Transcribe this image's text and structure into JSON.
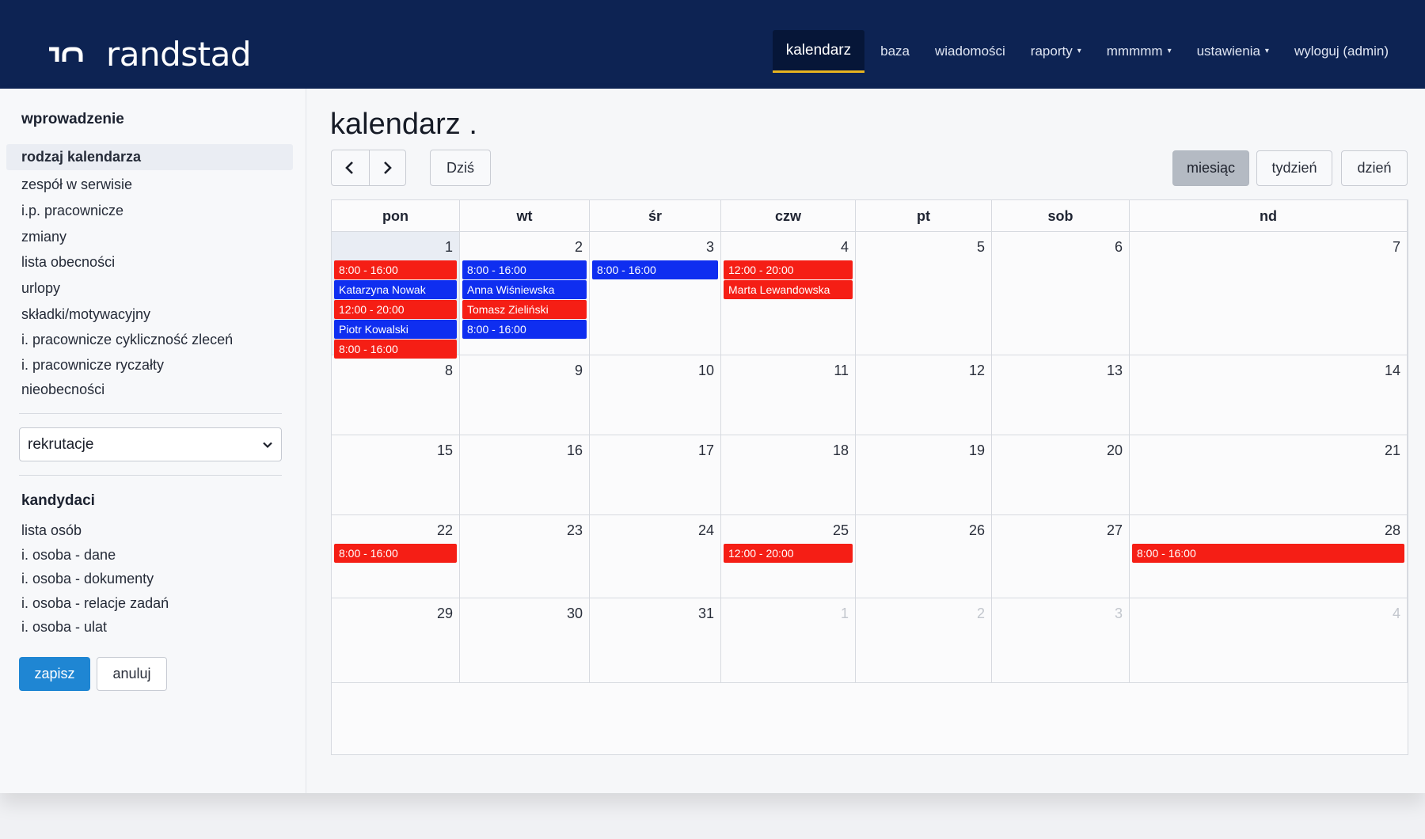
{
  "brand": {
    "name": "randstad"
  },
  "nav": [
    {
      "label": "kalendarz",
      "active": true,
      "dropdown": false
    },
    {
      "label": "baza",
      "active": false,
      "dropdown": false
    },
    {
      "label": "wiadomości",
      "active": false,
      "dropdown": false
    },
    {
      "label": "raporty",
      "active": false,
      "dropdown": true
    },
    {
      "label": "mmmmm",
      "active": false,
      "dropdown": true
    },
    {
      "label": "ustawienia",
      "active": false,
      "dropdown": true
    },
    {
      "label": "wyloguj (admin)",
      "active": false,
      "dropdown": false
    }
  ],
  "sidebar": {
    "section1_title": "wprowadzenie",
    "items": [
      "rodzaj kalendarza",
      "zespół w serwisie",
      "i.p. pracownicze",
      "zmiany",
      "lista obecności",
      "urlopy",
      "składki/motywacyjny",
      "i. pracownicze cykliczność zleceń",
      "i. pracownicze ryczałty",
      "nieobecności"
    ],
    "select_value": "rekrutacje",
    "section2_title": "kandydaci",
    "items2": [
      "lista osób",
      "i. osoba - dane",
      "i. osoba - dokumenty",
      "i. osoba - relacje zadań",
      "i. osoba - ulat"
    ],
    "save_label": "zapisz",
    "cancel_label": "anuluj"
  },
  "main": {
    "title": "kalendarz .",
    "today_label": "Dziś",
    "views": [
      {
        "label": "miesiąc",
        "active": true
      },
      {
        "label": "tydzień",
        "active": false
      },
      {
        "label": "dzień",
        "active": false
      }
    ]
  },
  "calendar": {
    "weekdays": [
      "pon",
      "wt",
      "śr",
      "czw",
      "pt",
      "sob",
      "nd"
    ],
    "today": 1,
    "weeks": [
      [
        {
          "day": "1"
        },
        {
          "day": "2"
        },
        {
          "day": "3"
        },
        {
          "day": "4"
        },
        {
          "day": "5"
        },
        {
          "day": "6"
        },
        {
          "day": "7"
        }
      ],
      [
        {
          "day": "8"
        },
        {
          "day": "9"
        },
        {
          "day": "10"
        },
        {
          "day": "11"
        },
        {
          "day": "12"
        },
        {
          "day": "13"
        },
        {
          "day": "14"
        }
      ],
      [
        {
          "day": "15"
        },
        {
          "day": "16"
        },
        {
          "day": "17"
        },
        {
          "day": "18"
        },
        {
          "day": "19"
        },
        {
          "day": "20"
        },
        {
          "day": "21"
        }
      ],
      [
        {
          "day": "22"
        },
        {
          "day": "23"
        },
        {
          "day": "24"
        },
        {
          "day": "25"
        },
        {
          "day": "26"
        },
        {
          "day": "27"
        },
        {
          "day": "28"
        }
      ],
      [
        {
          "day": "29"
        },
        {
          "day": "30"
        },
        {
          "day": "31"
        },
        {
          "day": "1",
          "other_month": true
        },
        {
          "day": "2",
          "other_month": true
        },
        {
          "day": "3",
          "other_month": true
        },
        {
          "day": "4",
          "other_month": true
        }
      ]
    ],
    "events": [
      {
        "day": 1,
        "text": "8:00 - 16:00",
        "color": "red"
      },
      {
        "day": 1,
        "text": "Katarzyna Nowak",
        "color": "blue"
      },
      {
        "day": 1,
        "text": "12:00 - 20:00",
        "color": "red"
      },
      {
        "day": 1,
        "text": "Piotr Kowalski",
        "color": "blue"
      },
      {
        "day": 1,
        "text": "8:00 - 16:00",
        "color": "red"
      },
      {
        "day": 2,
        "text": "8:00 - 16:00",
        "color": "blue"
      },
      {
        "day": 2,
        "text": "Anna Wiśniewska",
        "color": "blue"
      },
      {
        "day": 2,
        "text": "Tomasz Zieliński",
        "color": "red"
      },
      {
        "day": 2,
        "text": "8:00 - 16:00",
        "color": "blue"
      },
      {
        "day": 3,
        "text": "8:00 - 16:00",
        "color": "blue"
      },
      {
        "day": 4,
        "text": "12:00 - 20:00",
        "color": "red"
      },
      {
        "day": 4,
        "text": "Marta Lewandowska",
        "color": "red"
      },
      {
        "day": 22,
        "text": "8:00 - 16:00",
        "color": "red"
      },
      {
        "day": 25,
        "text": "12:00 - 20:00",
        "color": "red"
      },
      {
        "day": 28,
        "text": "8:00 - 16:00",
        "color": "red"
      }
    ]
  },
  "colors": {
    "header_bg": "#0d2353",
    "nav_active_underline": "#e6b420",
    "primary_button": "#1f86d3",
    "event_red": "#f51e15",
    "event_blue": "#0f2ef0"
  }
}
